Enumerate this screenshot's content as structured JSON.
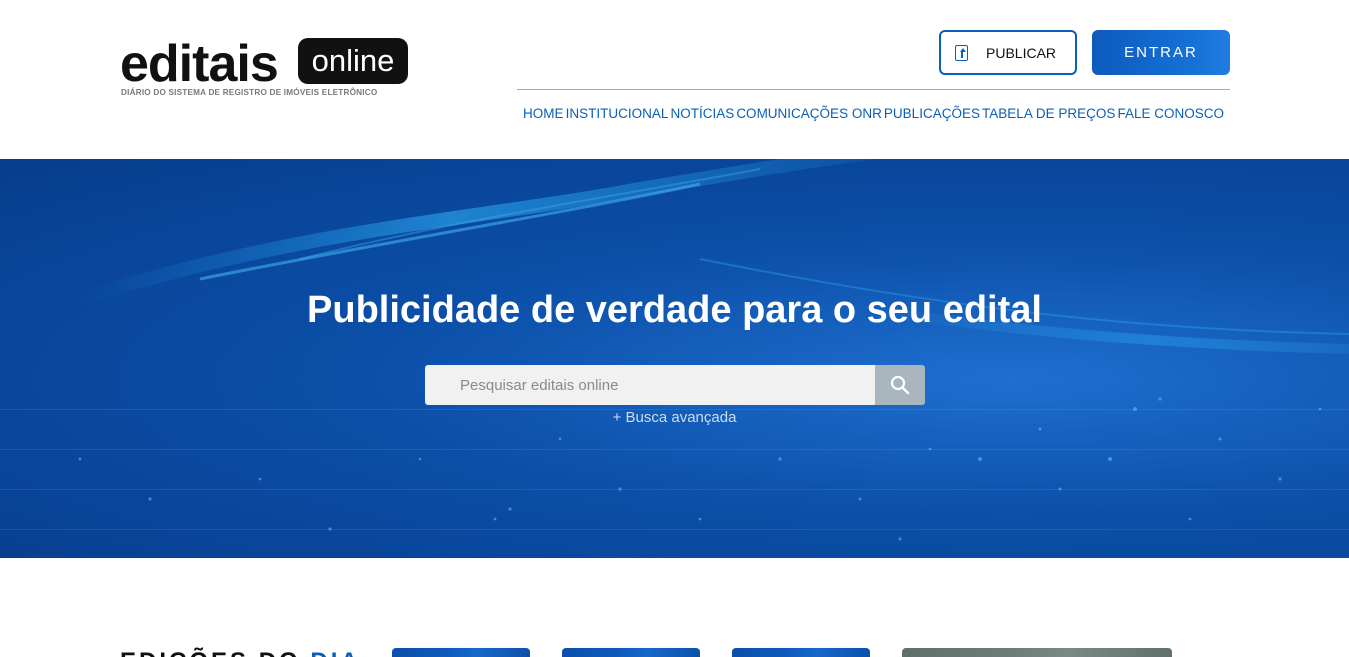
{
  "header": {
    "logo": {
      "word": "editais",
      "box": "online",
      "subtitle": "DIÁRIO DO SISTEMA DE REGISTRO DE IMÓVEIS ELETRÔNICO"
    },
    "publicar_label": "PUBLICAR",
    "entrar_label": "ENTRAR",
    "nav": [
      {
        "label": "HOME"
      },
      {
        "label": "INSTITUCIONAL"
      },
      {
        "label": "NOTÍCIAS"
      },
      {
        "label": "COMUNICAÇÕES ONR"
      },
      {
        "label": "PUBLICAÇÕES"
      },
      {
        "label": "TABELA DE PREÇOS"
      },
      {
        "label": "FALE CONOSCO"
      }
    ]
  },
  "hero": {
    "title_pre": "Publicidade ",
    "title_bold": "de verdade",
    "title_post": " para o seu edital",
    "search_placeholder": "Pesquisar editais online",
    "search_icon": "search-icon",
    "advanced_search": "+ Busca avançada"
  },
  "section": {
    "title_pre": "EDIÇÕES DO ",
    "title_accent": "DIA"
  },
  "colors": {
    "brand_blue": "#0b5fb8",
    "hero_dark": "#073d8c",
    "search_button": "#a9b6bd"
  }
}
